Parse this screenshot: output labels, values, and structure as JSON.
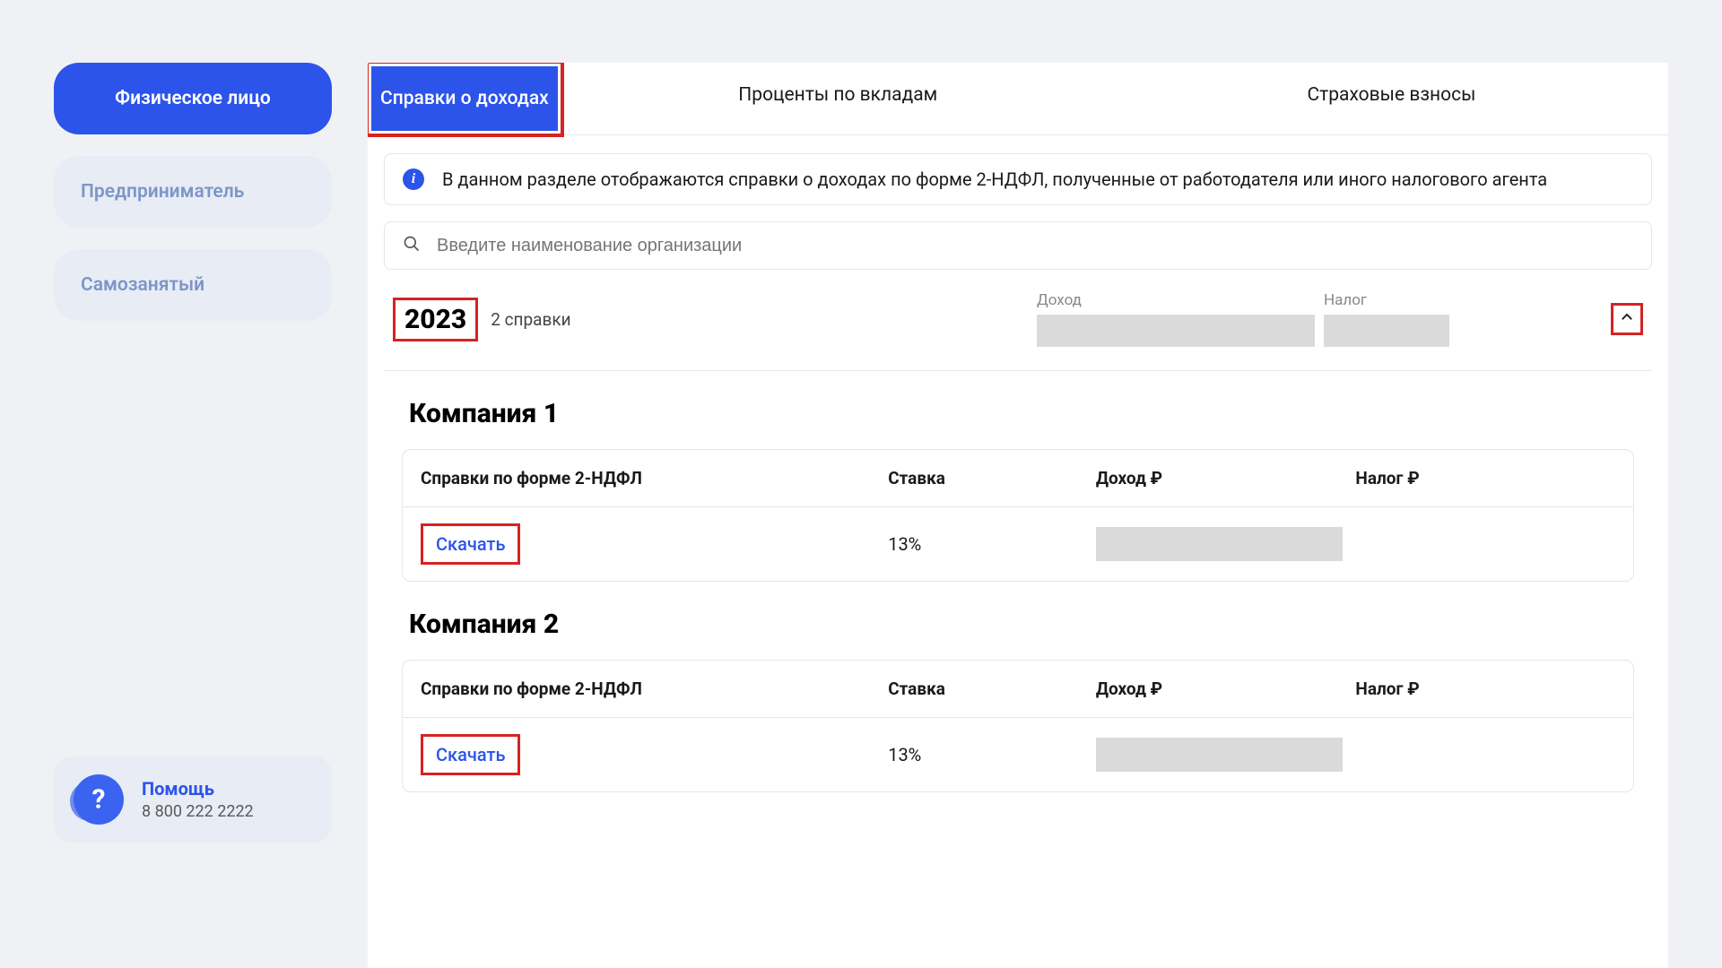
{
  "sidebar": {
    "items": [
      {
        "label": "Физическое лицо",
        "active": true
      },
      {
        "label": "Предприниматель",
        "active": false
      },
      {
        "label": "Самозанятый",
        "active": false
      }
    ],
    "help": {
      "title": "Помощь",
      "phone": "8 800 222 2222"
    }
  },
  "tabs": [
    {
      "label": "Справки о доходах",
      "active": true
    },
    {
      "label": "Проценты по вкладам",
      "active": false
    },
    {
      "label": "Страховые взносы",
      "active": false
    }
  ],
  "info_text": "В данном разделе отображаются справки о доходах по форме 2-НДФЛ, полученные от работодателя или иного налогового агента",
  "search_placeholder": "Введите наименование организации",
  "year_section": {
    "year": "2023",
    "count_label": "2 справки",
    "income_header": "Доход",
    "tax_header": "Налог"
  },
  "table_headers": {
    "col1": "Справки по форме 2-НДФЛ",
    "col2": "Ставка",
    "col3": "Доход ₽",
    "col4": "Налог ₽"
  },
  "companies": [
    {
      "name": "Компания 1",
      "download_label": "Скачать",
      "rate": "13%"
    },
    {
      "name": "Компания 2",
      "download_label": "Скачать",
      "rate": "13%"
    }
  ]
}
